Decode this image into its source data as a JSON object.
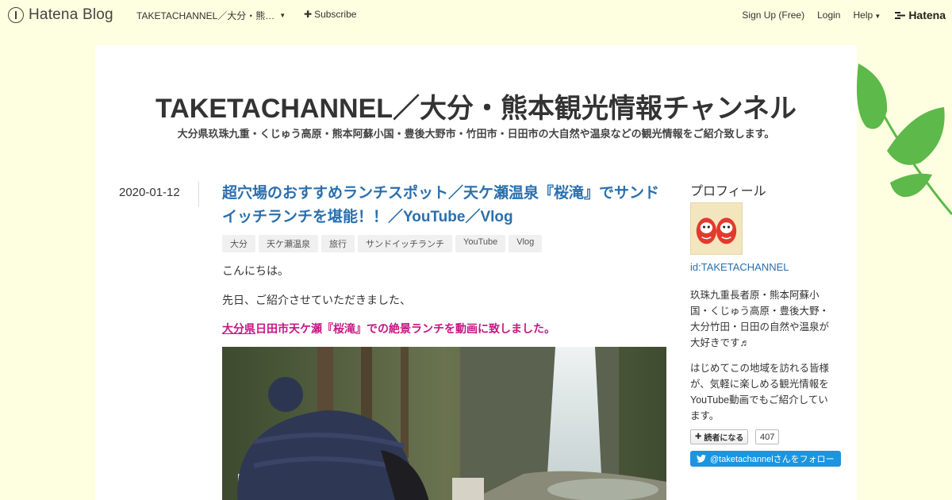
{
  "topbar": {
    "logo_text": "Hatena Blog",
    "blog_select_label": "TAKETACHANNEL／大分・熊…",
    "subscribe_label": "Subscribe",
    "signup_label": "Sign Up (Free)",
    "login_label": "Login",
    "help_label": "Help",
    "brand_label": "Hatena"
  },
  "blog": {
    "title": "TAKETACHANNEL／大分・熊本観光情報チャンネル",
    "description": "大分県玖珠九重・くじゅう高原・熊本阿蘇小国・豊後大野市・竹田市・日田市の大自然や温泉などの観光情報をご紹介致します。"
  },
  "entry": {
    "date": "2020-01-12",
    "title": "超穴場のおすすめランチスポット／天ケ瀬温泉『桜滝』でサンドイッチランチを堪能！！／YouTube／Vlog",
    "tags": [
      "大分",
      "天ケ瀬温泉",
      "旅行",
      "サンドイッチランチ",
      "YouTube",
      "Vlog"
    ],
    "p1": "こんにちは。",
    "p2": "先日、ご紹介させていただきました、",
    "p3_link": "大分県",
    "p3_rest": "日田市天ケ瀬『桜滝』での絶景ランチを動画に致しました。"
  },
  "sidebar": {
    "heading": "プロフィール",
    "id": "id:TAKETACHANNEL",
    "text1": "玖珠九重長者原・熊本阿蘇小国・くじゅう高原・豊後大野・大分竹田・日田の自然や温泉が大好きです♬",
    "text2": "はじめてこの地域を訪れる皆様が、気軽に楽しめる観光情報をYouTube動画でもご紹介しています。",
    "reader_label": "読者になる",
    "reader_count": "407",
    "twitter_label": "@taketachannelさんをフォロー"
  },
  "colors": {
    "background": "#fefee0",
    "title_link": "#2a6fad",
    "highlight_text": "#c71585",
    "twitter": "#1b95e0",
    "leaf": "#5cb94a"
  }
}
